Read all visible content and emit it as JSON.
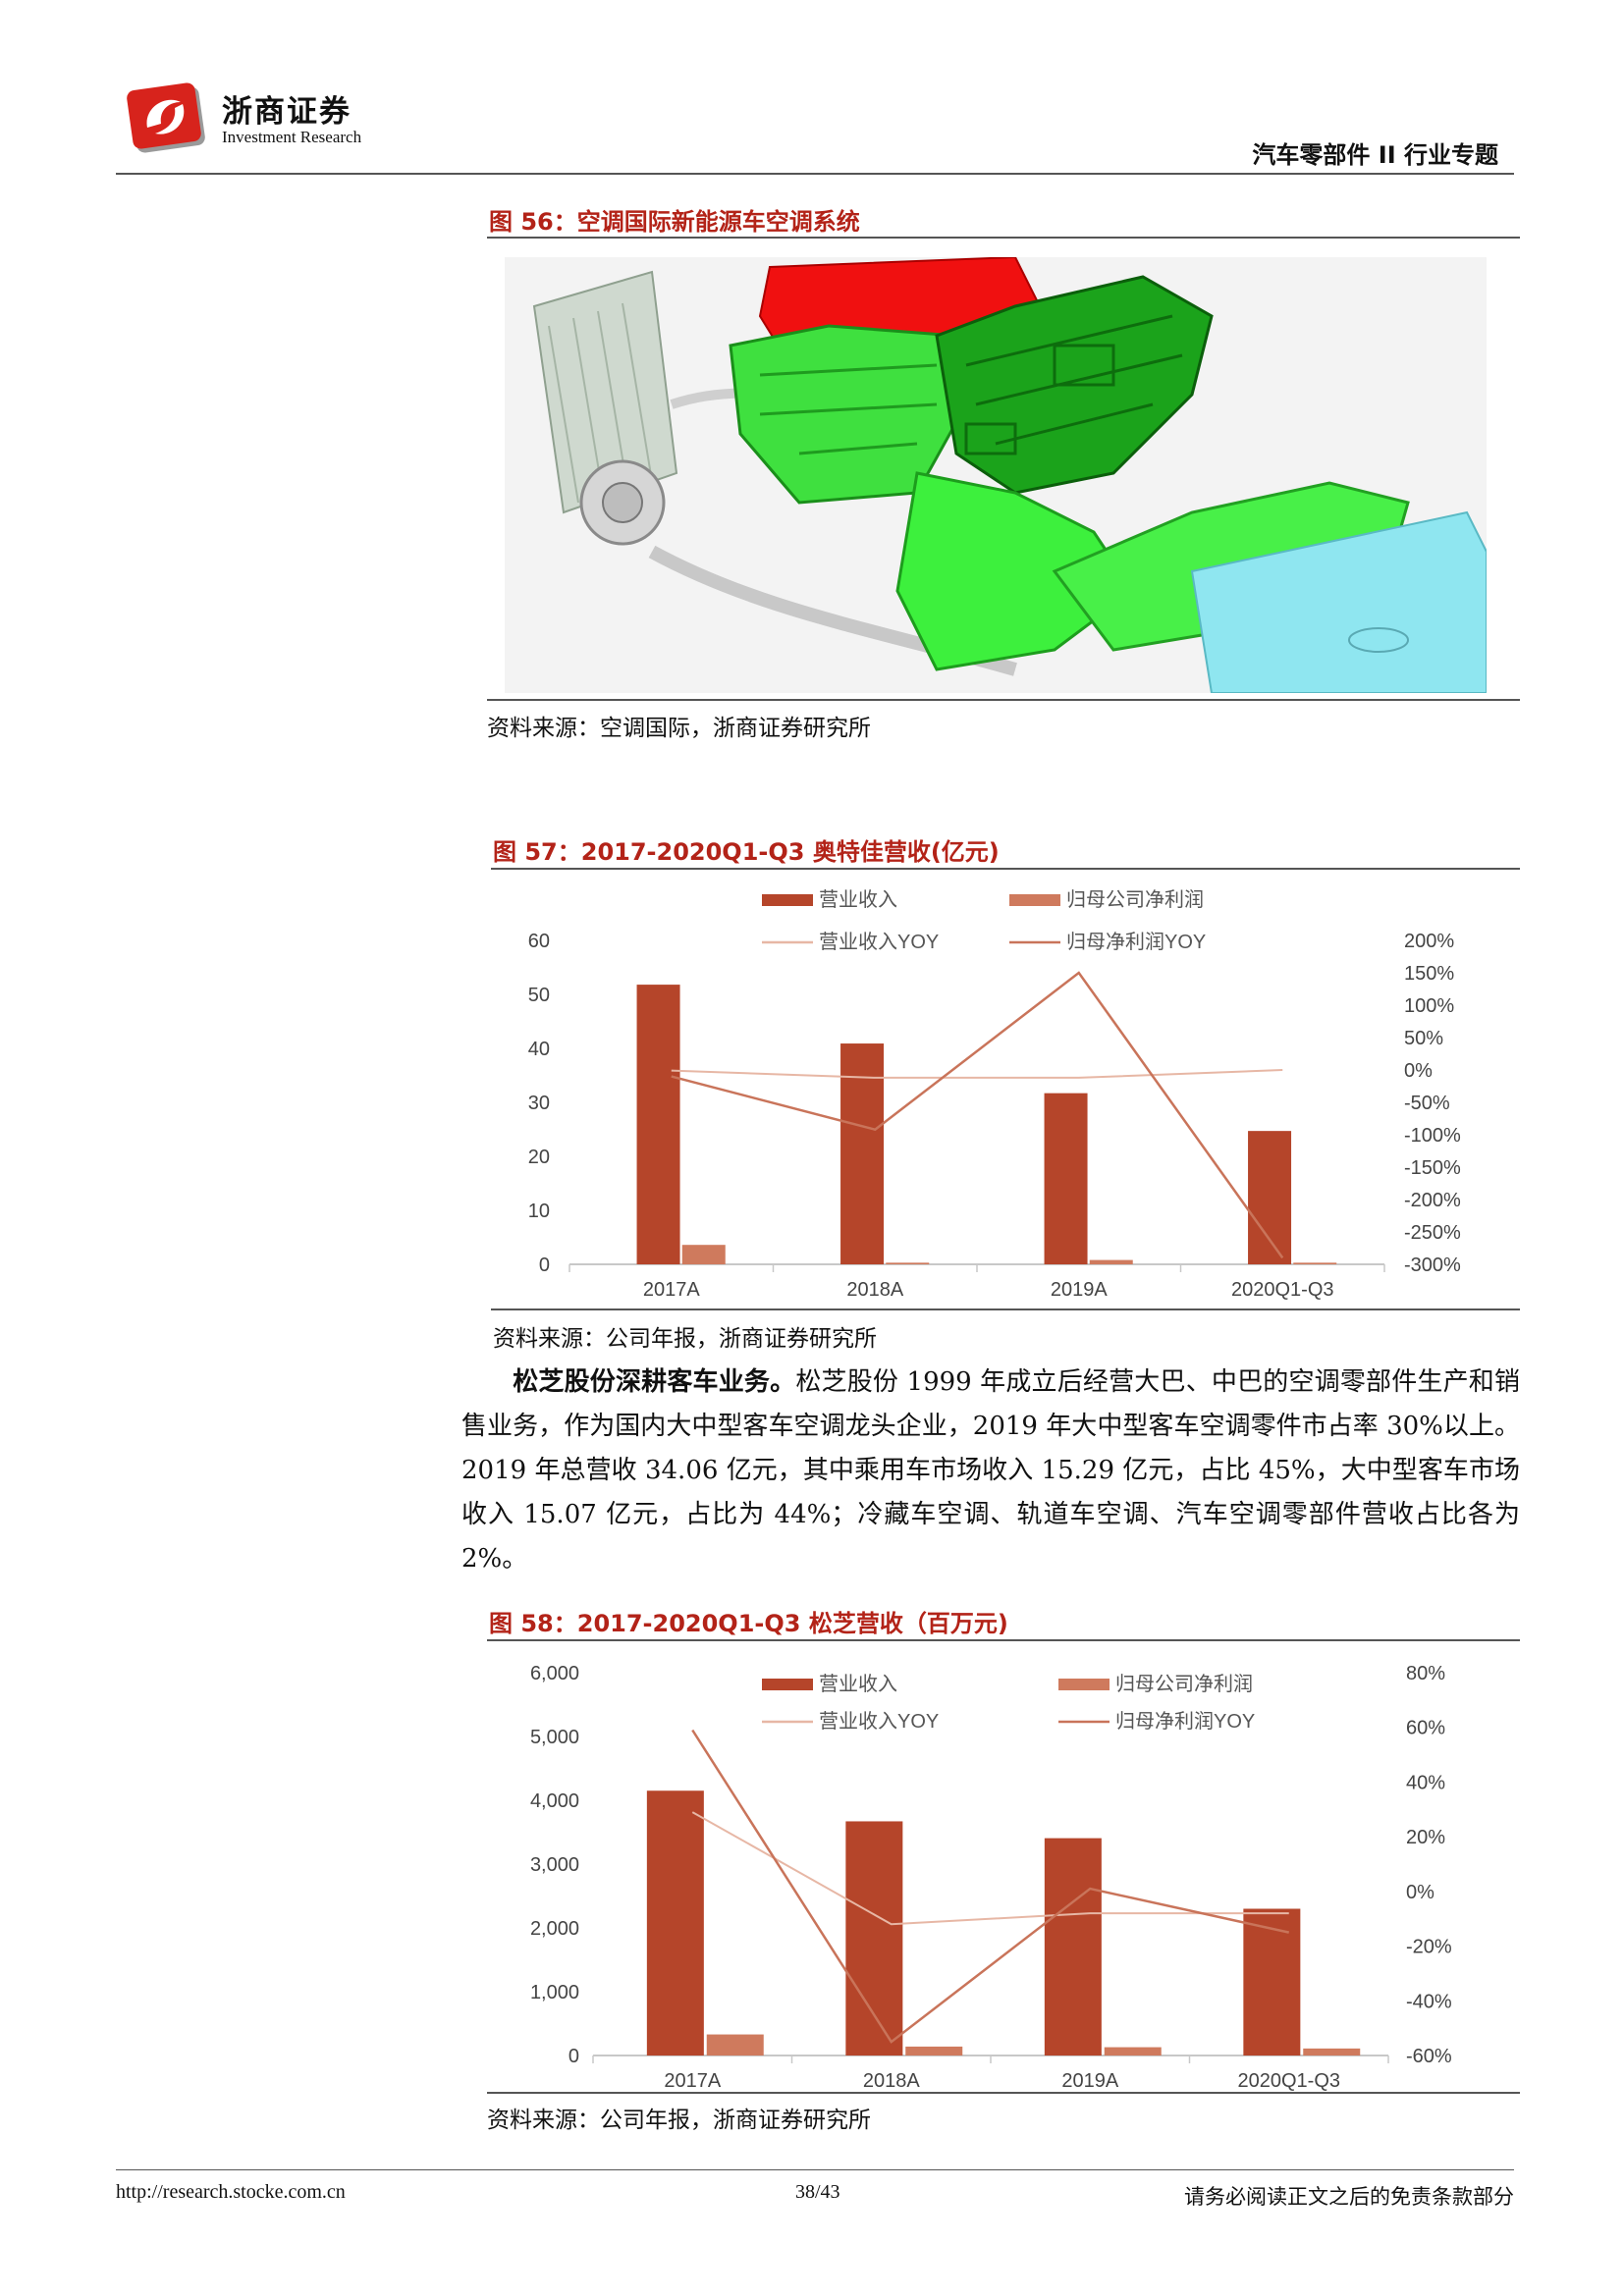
{
  "header": {
    "brand_cn": "浙商证券",
    "brand_en": "Investment Research",
    "section": "汽车零部件 II 行业专题"
  },
  "figure56": {
    "title": "图 56：空调国际新能源车空调系统",
    "source": "资料来源：空调国际，浙商证券研究所"
  },
  "figure57": {
    "title": "图 57：2017-2020Q1-Q3  奥特佳营收(亿元)",
    "source": "资料来源：公司年报，浙商证券研究所"
  },
  "paragraph": {
    "lead": "松芝股份深耕客车业务。",
    "body": "松芝股份 1999 年成立后经营大巴、中巴的空调零部件生产和销售业务，作为国内大中型客车空调龙头企业，2019 年大中型客车空调零件市占率 30%以上。2019 年总营收 34.06 亿元，其中乘用车市场收入 15.29 亿元，占比 45%，大中型客车市场收入 15.07 亿元，占比为 44%；冷藏车空调、轨道车空调、汽车空调零部件营收占比各为 2%。"
  },
  "figure58": {
    "title": "图 58：2017-2020Q1-Q3 松芝营收（百万元)",
    "source": "资料来源：公司年报，浙商证券研究所"
  },
  "footer": {
    "url": "http://research.stocke.com.cn",
    "page": "38/43",
    "disclaimer": "请务必阅读正文之后的免责条款部分"
  },
  "chart_data": [
    {
      "type": "bar",
      "categories": [
        "2017A",
        "2018A",
        "2019A",
        "2020Q1-Q3"
      ],
      "ylim": [
        0,
        60
      ],
      "yticks": [
        "0",
        "10",
        "20",
        "30",
        "40",
        "50",
        "60"
      ],
      "y2lim": [
        -300,
        200
      ],
      "y2ticks": [
        "-300%",
        "-250%",
        "-200%",
        "-150%",
        "-100%",
        "-50%",
        "0%",
        "50%",
        "100%",
        "150%",
        "200%"
      ],
      "series": [
        {
          "name": "营业收入",
          "kind": "bar",
          "axis": "left",
          "color": "#b5452a",
          "values": [
            51.8,
            40.9,
            31.7,
            24.7
          ]
        },
        {
          "name": "归母公司净利润",
          "kind": "bar",
          "axis": "left",
          "color": "#cf7a5d",
          "values": [
            3.6,
            0.3,
            0.8,
            0.3
          ]
        },
        {
          "name": "营业收入YOY",
          "kind": "line",
          "axis": "right",
          "color": "#e7b7a5",
          "values": [
            -1,
            -12,
            -12,
            0
          ]
        },
        {
          "name": "归母净利润YOY",
          "kind": "line",
          "axis": "right",
          "color": "#c9745a",
          "values": [
            -10,
            -92,
            150,
            -290
          ]
        }
      ]
    },
    {
      "type": "bar",
      "categories": [
        "2017A",
        "2018A",
        "2019A",
        "2020Q1-Q3"
      ],
      "ylim": [
        0,
        6000
      ],
      "yticks": [
        "0",
        "1,000",
        "2,000",
        "3,000",
        "4,000",
        "5,000",
        "6,000"
      ],
      "y2lim": [
        -60,
        80
      ],
      "y2ticks": [
        "-60%",
        "-40%",
        "-20%",
        "0%",
        "20%",
        "40%",
        "60%",
        "80%"
      ],
      "series": [
        {
          "name": "营业收入",
          "kind": "bar",
          "axis": "left",
          "color": "#b5452a",
          "values": [
            4150,
            3670,
            3406,
            2300
          ]
        },
        {
          "name": "归母公司净利润",
          "kind": "bar",
          "axis": "left",
          "color": "#cf7a5d",
          "values": [
            330,
            140,
            130,
            110
          ]
        },
        {
          "name": "营业收入YOY",
          "kind": "line",
          "axis": "right",
          "color": "#e7b7a5",
          "values": [
            29,
            -12,
            -8,
            -8
          ]
        },
        {
          "name": "归母净利润YOY",
          "kind": "line",
          "axis": "right",
          "color": "#c9745a",
          "values": [
            59,
            -55,
            1,
            -15
          ]
        }
      ]
    }
  ]
}
